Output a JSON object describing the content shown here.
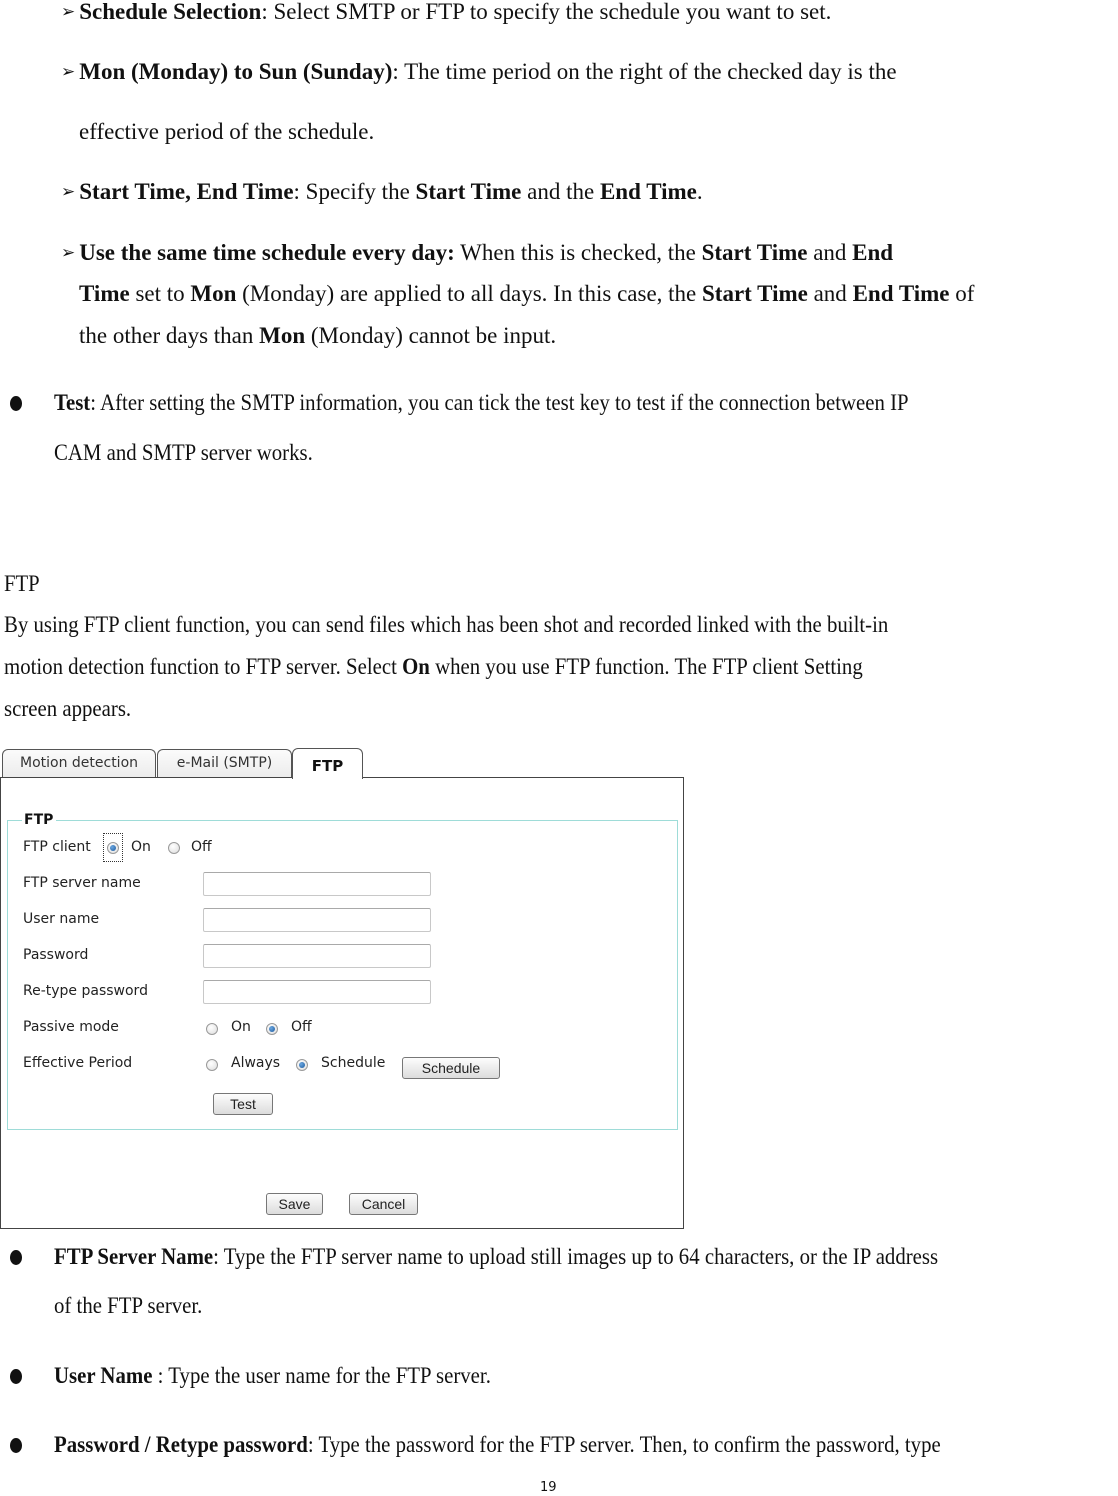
{
  "top_section": {
    "items": [
      {
        "term": "Schedule Selection",
        "text": ": Select SMTP or FTP to specify the schedule you want to set."
      },
      {
        "term": "Mon (Monday) to Sun (Sunday)",
        "text": ": The time period on the right of the checked day is the",
        "continuation": "effective period of the schedule."
      },
      {
        "term": "Start Time, End Time",
        "text1": ": Specify the ",
        "bold1": "Start Time",
        "text2": " and the ",
        "bold2": "End Time",
        "text3": "."
      },
      {
        "term": "Use the same time schedule every day:",
        "text1": " When this is checked, the ",
        "bold1": "Start Time",
        "text2": " and ",
        "bold2": "End",
        "line2_bold1": "Time",
        "line2_text1": " set to ",
        "line2_bold2": "Mon",
        "line2_text2": " (Monday) are applied to all days. In this case, the ",
        "line2_bold3": "Start Time",
        "line2_text3": " and ",
        "line2_bold4": "End Time",
        "line2_text4": " of",
        "line3_text1": "the other days than ",
        "line3_bold1": "Mon",
        "line3_text2": " (Monday) cannot be input."
      }
    ],
    "test_bullet": {
      "term": "Test",
      "text": ": After setting the SMTP information, you can tick the test key to test if the connection between IP",
      "continuation": "CAM and SMTP server works."
    }
  },
  "ftp_section": {
    "heading": "FTP",
    "intro_line1": "By using FTP client function, you can send files which has been shot and recorded linked with the built-in",
    "intro_line2_a": "motion detection function to FTP server. Select ",
    "intro_line2_bold": "On",
    "intro_line2_b": " when you use FTP function. The FTP client Setting",
    "intro_line3": "screen appears."
  },
  "screenshot": {
    "tabs": [
      {
        "label": "Motion detection",
        "active": false
      },
      {
        "label": "e-Mail (SMTP)",
        "active": false
      },
      {
        "label": "FTP",
        "active": true
      }
    ],
    "fieldset_legend": "FTP",
    "ftp_client": {
      "label": "FTP client",
      "options": [
        "On",
        "Off"
      ],
      "selected": "On"
    },
    "server_name": {
      "label": "FTP server name",
      "value": ""
    },
    "user_name": {
      "label": "User name",
      "value": ""
    },
    "password": {
      "label": "Password",
      "value": ""
    },
    "retype_password": {
      "label": "Re-type password",
      "value": ""
    },
    "passive_mode": {
      "label": "Passive mode",
      "options": [
        "On",
        "Off"
      ],
      "selected": "Off"
    },
    "effective_period": {
      "label": "Effective Period",
      "options": [
        "Always",
        "Schedule"
      ],
      "selected": "Schedule",
      "button": "Schedule"
    },
    "test_button": "Test",
    "save_button": "Save",
    "cancel_button": "Cancel"
  },
  "bottom_section": {
    "items": [
      {
        "term": "FTP Server Name",
        "text": ": Type the FTP server name to upload still images up to 64 characters, or the IP address",
        "continuation": "of the FTP server."
      },
      {
        "term": "User Name ",
        "text": ": Type the user name for the FTP server."
      },
      {
        "term": "Password / Retype password",
        "text": ": Type the password for the FTP server. Then, to confirm the password, type"
      }
    ]
  },
  "page_number": "19"
}
